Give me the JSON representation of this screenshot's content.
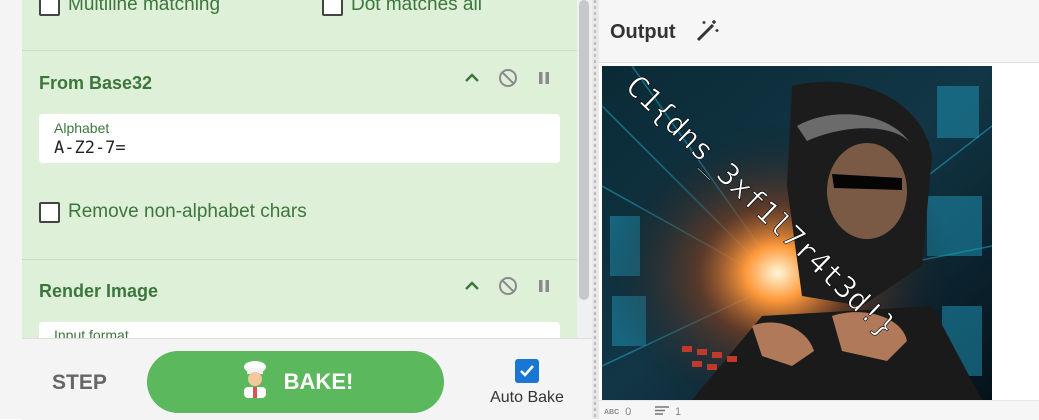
{
  "recipe": {
    "regex_options": {
      "multiline_label": "Multiline matching",
      "dotall_label": "Dot matches all"
    },
    "from_base32": {
      "title": "From Base32",
      "alphabet_label": "Alphabet",
      "alphabet_value": "A-Z2-7=",
      "remove_label": "Remove non-alphabet chars"
    },
    "render_image": {
      "title": "Render Image",
      "input_format_label": "Input format"
    }
  },
  "controls": {
    "step_label": "STEP",
    "bake_label": "BAKE!",
    "autobake_label": "Auto Bake",
    "autobake_checked": true
  },
  "output": {
    "title": "Output",
    "image_text": "C1{dns_3xf1l7r4t3d!}",
    "length_value": "0",
    "lines_value": "1"
  },
  "colors": {
    "op_bg": "#dff0d8",
    "op_text": "#3c763d",
    "bake_green": "#5cb85c",
    "autobake_blue": "#1976d2"
  }
}
